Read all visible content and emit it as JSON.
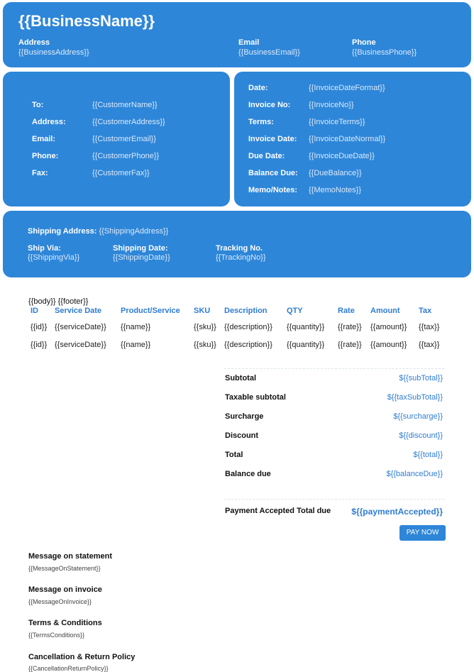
{
  "header": {
    "business_name": "{{BusinessName}}",
    "address_label": "Address",
    "address_value": "{{BusinessAddress}}",
    "email_label": "Email",
    "email_value": "{{BusinessEmail}}",
    "phone_label": "Phone",
    "phone_value": "{{BusinessPhone}}"
  },
  "customer": [
    {
      "label": "To:",
      "value": "{{CustomerName}}"
    },
    {
      "label": "Address:",
      "value": "{{CustomerAddress}}"
    },
    {
      "label": "Email:",
      "value": "{{CustomerEmail}}"
    },
    {
      "label": "Phone:",
      "value": "{{CustomerPhone}}"
    },
    {
      "label": "Fax:",
      "value": "{{CustomerFax}}"
    }
  ],
  "invoice": [
    {
      "label": "Date:",
      "value": "{{InvoiceDateFormat}}"
    },
    {
      "label": "Invoice No:",
      "value": "{{InvoiceNo}}"
    },
    {
      "label": "Terms:",
      "value": "{{InvoiceTerms}}"
    },
    {
      "label": "Invoice Date:",
      "value": "{{InvoiceDateNormal}}"
    },
    {
      "label": "Due Date:",
      "value": "{{InvoiceDueDate}}"
    },
    {
      "label": "Balance Due:",
      "value": "{{DueBalance}}"
    },
    {
      "label": "Memo/Notes:",
      "value": "{{MemoNotes}}"
    }
  ],
  "shipping": {
    "address_label": "Shipping Address:",
    "address_value": "{{ShippingAddress}}",
    "via_label": "Ship Via:",
    "via_value": "{{ShippingVia}}",
    "date_label": "Shipping Date:",
    "date_value": "{{ShippingDate}}",
    "tracking_label": "Tracking No.",
    "tracking_value": "{{TrackingNo}}"
  },
  "body_footer": "{{body}} {{footer}}",
  "items": {
    "headers": [
      "ID",
      "Service Date",
      "Product/Service",
      "SKU",
      "Description",
      "QTY",
      "Rate",
      "Amount",
      "Tax"
    ],
    "rows": [
      [
        "{{id}}",
        "{{serviceDate}}",
        "{{name}}",
        "{{sku}}",
        "{{description}}",
        "{{quantity}}",
        "{{rate}}",
        "{{amount}}",
        "{{tax}}"
      ],
      [
        "{{id}}",
        "{{serviceDate}}",
        "{{name}}",
        "{{sku}}",
        "{{description}}",
        "{{quantity}}",
        "{{rate}}",
        "{{amount}}",
        "{{tax}}"
      ]
    ]
  },
  "totals": [
    {
      "label": "Subtotal",
      "value": "${{subTotal}}"
    },
    {
      "label": "Taxable subtotal",
      "value": "${{taxSubTotal}}"
    },
    {
      "label": "Surcharge",
      "value": "${{surcharge}}"
    },
    {
      "label": "Discount",
      "value": "${{discount}}"
    },
    {
      "label": "Total",
      "value": "${{total}}"
    },
    {
      "label": "Balance due",
      "value": "${{balanceDue}}"
    }
  ],
  "payment": {
    "label": "Payment Accepted Total due",
    "value": "${{paymentAccepted}}",
    "button": "PAY NOW"
  },
  "messages": [
    {
      "heading": "Message on statement",
      "value": "{{MessageOnStatement}}"
    },
    {
      "heading": "Message on invoice",
      "value": "{{MessageOnInvoice}}"
    },
    {
      "heading": "Terms & Conditions",
      "value": "{{TermsConditions}}"
    },
    {
      "heading": "Cancellation & Return Policy",
      "value": "{{CancellationReturnPolicy}}"
    }
  ]
}
